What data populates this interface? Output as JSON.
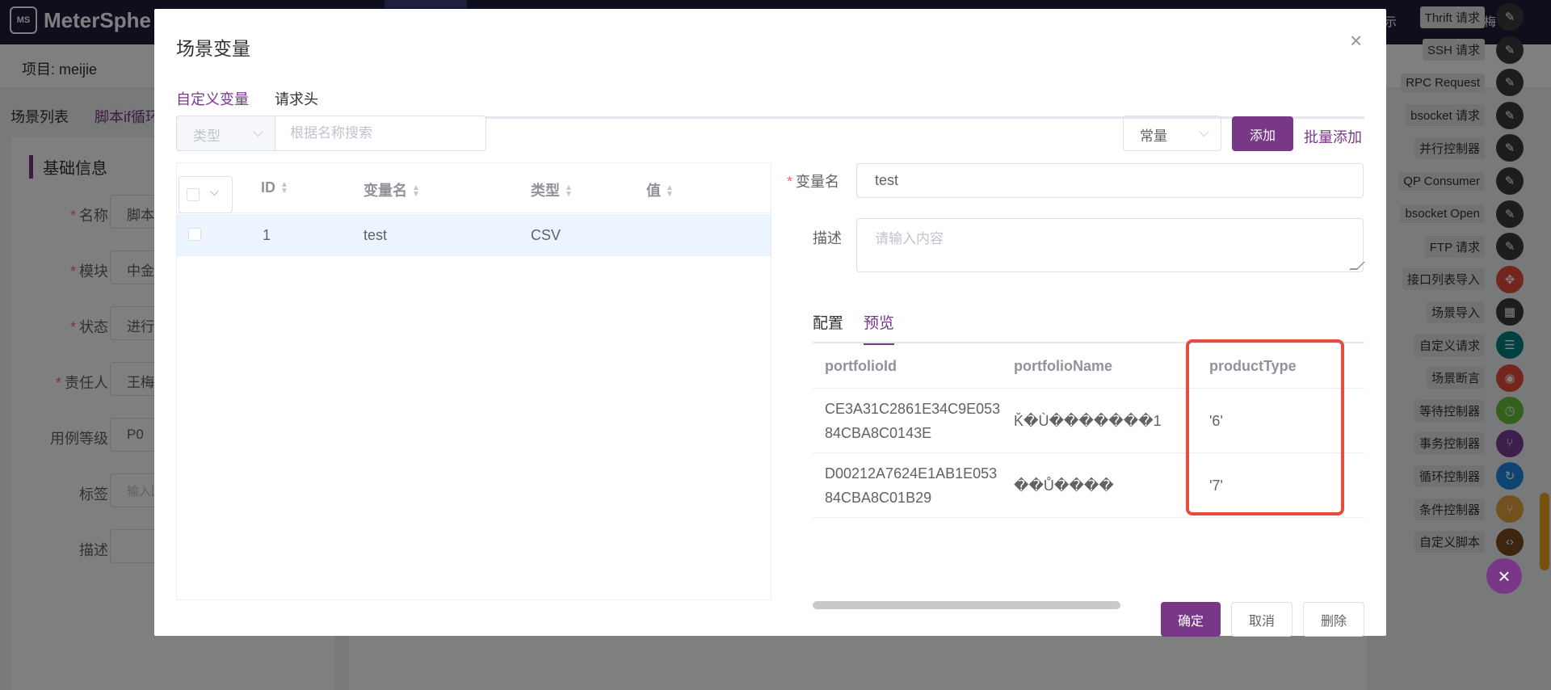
{
  "app": {
    "logo_text": "MeterSphe",
    "user": "王梅",
    "shi": "示"
  },
  "project": {
    "label": "项目: meijie"
  },
  "scene_tabs": [
    "场景列表",
    "脚本if循环"
  ],
  "form": {
    "section_title": "基础信息",
    "rows": [
      {
        "label": "名称",
        "required": true,
        "value": "脚本"
      },
      {
        "label": "模块",
        "required": true,
        "value": "中金"
      },
      {
        "label": "状态",
        "required": true,
        "value": "进行"
      },
      {
        "label": "责任人",
        "required": true,
        "value": "王梅"
      },
      {
        "label": "用例等级",
        "required": false,
        "value": "P0"
      },
      {
        "label": "标签",
        "required": false,
        "value": "输入回"
      },
      {
        "label": "描述",
        "required": false,
        "value": ""
      }
    ]
  },
  "components": [
    {
      "label": "Thrift 请求",
      "color": "#3a3a3a",
      "icon": "pen-icon"
    },
    {
      "label": "SSH 请求",
      "color": "#3a3a3a",
      "icon": "pen-icon"
    },
    {
      "label": "RPC Request",
      "color": "#3a3a3a",
      "icon": "pen-icon"
    },
    {
      "label": "bsocket 请求",
      "color": "#3a3a3a",
      "icon": "pen-icon"
    },
    {
      "label": "并行控制器",
      "color": "#3a3a3a",
      "icon": "pen-icon"
    },
    {
      "label": "QP Consumer",
      "color": "#3a3a3a",
      "icon": "pen-icon"
    },
    {
      "label": "bsocket Open",
      "color": "#3a3a3a",
      "icon": "pen-icon"
    },
    {
      "label": "FTP 请求",
      "color": "#3a3a3a",
      "icon": "pen-icon"
    },
    {
      "label": "接口列表导入",
      "color": "#e74c3c",
      "icon": "move-icon"
    },
    {
      "label": "场景导入",
      "color": "#3a3a3a",
      "icon": "film-icon"
    },
    {
      "label": "自定义请求",
      "color": "#008080",
      "icon": "sliders-icon"
    },
    {
      "label": "场景断言",
      "color": "#e74c3c",
      "icon": "assert-icon"
    },
    {
      "label": "等待控制器",
      "color": "#67c23a",
      "icon": "clock-icon"
    },
    {
      "label": "事务控制器",
      "color": "#7b3f98",
      "icon": "branch-icon"
    },
    {
      "label": "循环控制器",
      "color": "#1e88e5",
      "icon": "loop-icon"
    },
    {
      "label": "条件控制器",
      "color": "#e6a23c",
      "icon": "branch-icon"
    },
    {
      "label": "自定义脚本",
      "color": "#7d4a1e",
      "icon": "code-icon"
    }
  ],
  "dialog": {
    "title": "场景变量",
    "tabs": [
      "自定义变量",
      "请求头"
    ],
    "filter": {
      "type_placeholder": "类型",
      "search_placeholder": "根据名称搜索"
    },
    "const_select": "常量",
    "add_label": "添加",
    "batch_add_label": "批量添加",
    "table": {
      "columns": [
        "ID",
        "变量名",
        "类型",
        "值"
      ],
      "rows": [
        {
          "id": "1",
          "name": "test",
          "type": "CSV",
          "value": ""
        }
      ]
    },
    "var_name_label": "变量名",
    "var_name_value": "test",
    "desc_label": "描述",
    "desc_placeholder": "请输入内容",
    "subtabs": [
      "配置",
      "预览"
    ],
    "preview": {
      "columns": [
        "portfolioId",
        "portfolioName",
        "productType"
      ],
      "rows": [
        [
          "CE3A31C2861E34C9E05384CBA8C0143E",
          "Ǩ�Ù�������1",
          "'6'"
        ],
        [
          "D00212A7624E1AB1E05384CBA8C01B29",
          "��Ů����",
          "'7'"
        ]
      ]
    },
    "buttons": {
      "ok": "确定",
      "cancel": "取消",
      "delete": "删除"
    }
  }
}
